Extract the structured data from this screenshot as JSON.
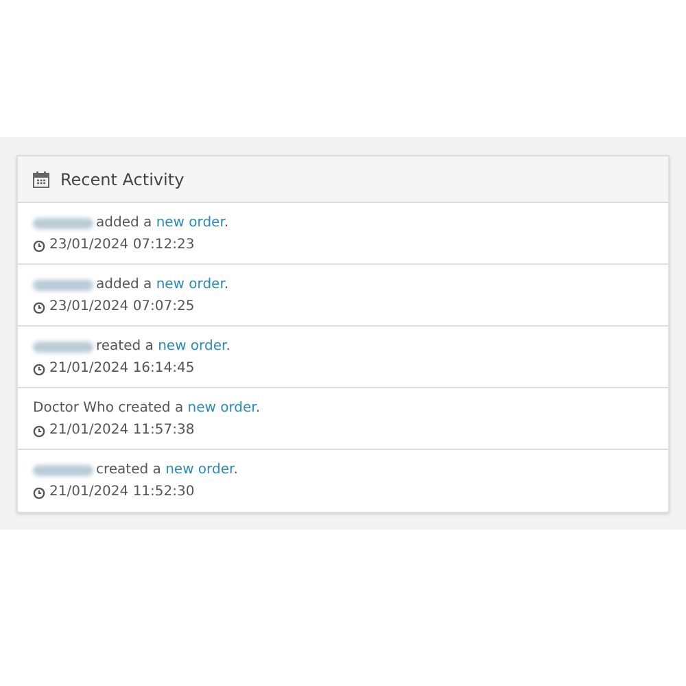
{
  "panel": {
    "title": "Recent Activity"
  },
  "activity": [
    {
      "redacted": true,
      "text": "added a ",
      "link": "new order",
      "suffix": ".",
      "time": "23/01/2024 07:12:23"
    },
    {
      "redacted": true,
      "text": "added a ",
      "link": "new order",
      "suffix": ".",
      "time": "23/01/2024 07:07:25"
    },
    {
      "redacted": true,
      "text": "reated a ",
      "link": "new order",
      "suffix": ".",
      "time": "21/01/2024 16:14:45"
    },
    {
      "text": "Doctor Who created a ",
      "link": "new order",
      "suffix": ".",
      "time": "21/01/2024 11:57:38"
    },
    {
      "redacted": true,
      "text": "created a ",
      "link": "new order",
      "suffix": ".",
      "time": "21/01/2024 11:52:30"
    }
  ]
}
